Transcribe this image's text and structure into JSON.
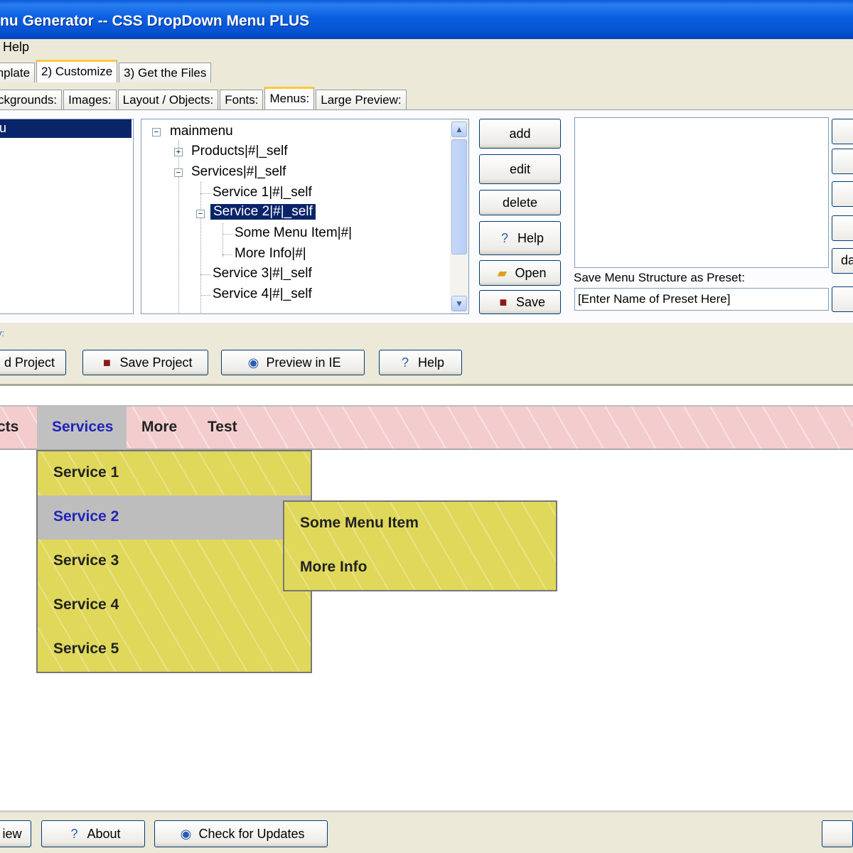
{
  "window": {
    "title": "nu Generator -- CSS DropDown Menu PLUS"
  },
  "menubar": {
    "help": "Help"
  },
  "tabs_main": [
    "mplate",
    "2) Customize",
    "3) Get the Files"
  ],
  "tabs_sub": [
    "ckgrounds:",
    "Images:",
    "Layout / Objects:",
    "Fonts:",
    "Menus:",
    "Large Preview:"
  ],
  "menu_list": {
    "selected": "u"
  },
  "tree": {
    "root": "mainmenu",
    "products": "Products|#|_self",
    "services": "Services|#|_self",
    "service1": "Service 1|#|_self",
    "service2": "Service 2|#|_self",
    "some_menu_item": "Some Menu Item|#|",
    "more_info": "More Info|#|",
    "service3": "Service 3|#|_self",
    "service4": "Service 4|#|_self"
  },
  "tree_buttons": {
    "add": "add",
    "edit": "edit",
    "delete": "delete",
    "help": "Help",
    "open": "Open",
    "save": "Save"
  },
  "preset": {
    "label": "Save Menu Structure as Preset:",
    "input_value": "[Enter Name of Preset Here]"
  },
  "right_buttons": {
    "fifth": "da"
  },
  "section_label": "v:",
  "project_buttons": {
    "load": "d Project",
    "save": "Save Project",
    "preview": "Preview in IE",
    "help": "Help"
  },
  "preview_menu": {
    "items": [
      "cts",
      "Services",
      "More",
      "Test"
    ],
    "dropdown": [
      "Service 1",
      "Service 2",
      "Service 3",
      "Service 4",
      "Service 5"
    ],
    "submenu": [
      "Some Menu Item",
      "More Info"
    ]
  },
  "status_buttons": {
    "view": "iew",
    "about": "About",
    "update": "Check for Updates"
  }
}
